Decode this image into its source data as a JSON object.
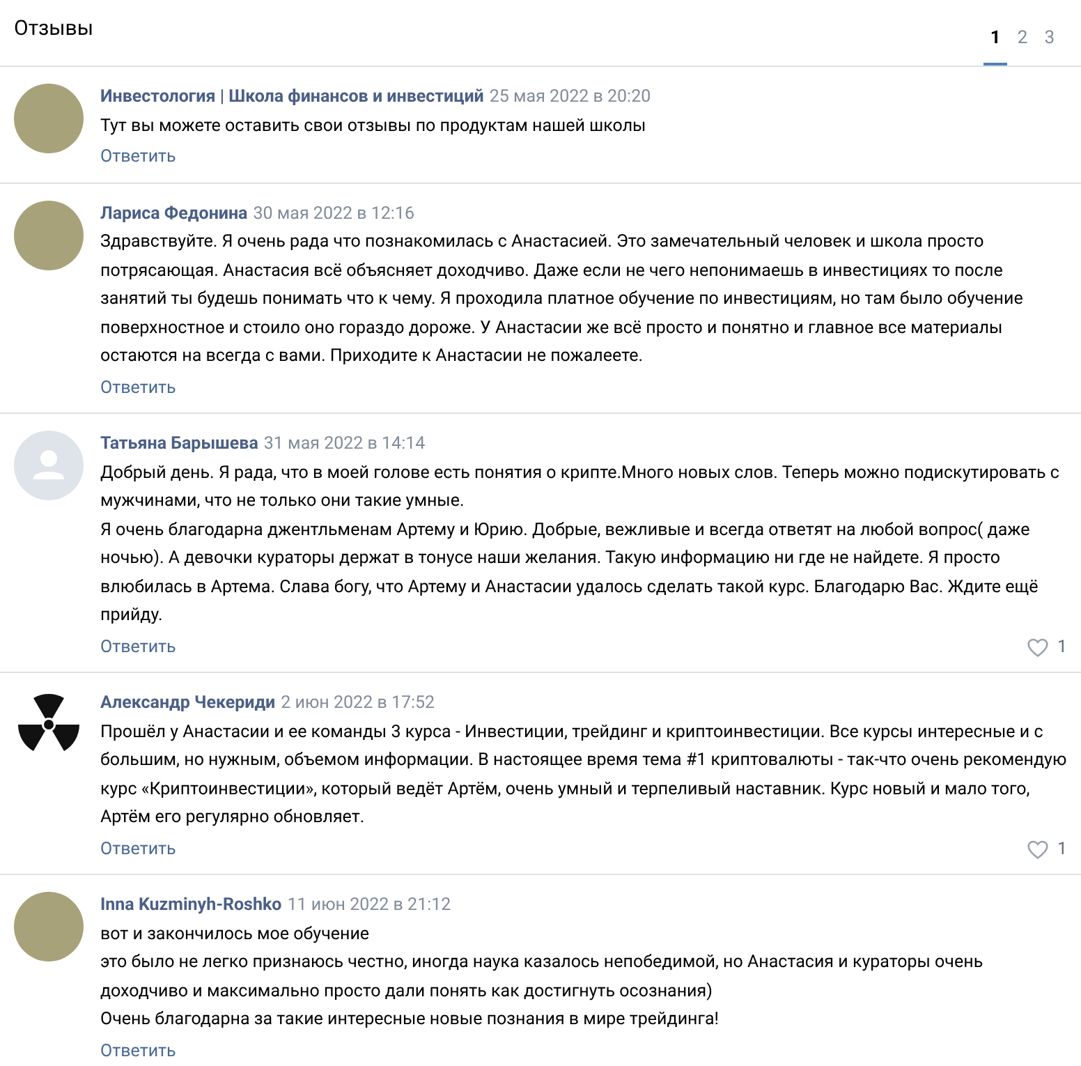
{
  "title": "Отзывы",
  "pages": [
    {
      "label": "1",
      "selected": true
    },
    {
      "label": "2",
      "selected": false
    },
    {
      "label": "3",
      "selected": false
    }
  ],
  "comments": [
    {
      "kind": "photo",
      "author": "Инвестология | Школа финансов и инвестиций",
      "date": "25 мая 2022 в 20:20",
      "paragraphs": [
        "Тут вы можете оставить свои отзывы по продуктам нашей школы"
      ],
      "reply": "Ответить"
    },
    {
      "kind": "photo",
      "author": "Лариса Федонина",
      "date": "30 мая 2022 в 12:16",
      "paragraphs": [
        "Здравствуйте. Я очень рада что познакомилась с Анастасией. Это замечательный человек и школа просто потрясающая. Анастасия всё объясняет доходчиво. Даже если не чего непонимаешь в инвестициях то после занятий ты будешь понимать что к чему. Я проходила платное обучение по инвестициям, но там было обучение поверхностное и стоило оно гораздо дороже. У Анастасии же всё просто и понятно и главное все материалы остаются на всегда с вами. Приходите к Анастасии не пожалеете."
      ],
      "reply": "Ответить"
    },
    {
      "kind": "silhouette",
      "author": "Татьяна Барышева",
      "date": "31 мая 2022 в 14:14",
      "paragraphs": [
        "Добрый день. Я рада, что в моей голове есть понятия о крипте.Много новых слов. Теперь можно подискутировать с мужчинами, что не только они такие умные.",
        "Я очень благодарна джентльменам Артему и Юрию. Добрые, вежливые и всегда ответят на любой вопрос( даже ночью). А девочки кураторы держат в тонусе наши желания. Такую информацию ни где не найдете. Я просто влюбилась в Артема. Слава богу, что Артему и Анастасии удалось сделать такой курс. Благодарю Вас. Ждите ещё прийду."
      ],
      "reply": "Ответить",
      "likes": "1"
    },
    {
      "kind": "radiation",
      "author": "Александр Чекериди",
      "date": "2 июн 2022 в 17:52",
      "paragraphs": [
        "Прошёл у Анастасии и ее команды 3 курса - Инвестиции, трейдинг и криптоинвестиции. Все курсы интересные и с большим, но нужным, объемом информации. В настоящее время тема #1 криптовалюты - так-что очень рекомендую курс «Криптоинвестиции», который ведёт Артём, очень умный и терпеливый наставник. Курс новый и мало того, Артём его регулярно обновляет."
      ],
      "reply": "Ответить",
      "likes": "1"
    },
    {
      "kind": "photo",
      "author": "Inna Kuzminyh-Roshko",
      "date": "11 июн 2022 в 21:12",
      "paragraphs": [
        "вот и закончилось мое обучение",
        "это было не легко признаюсь честно, иногда наука казалось непобедимой, но Анастасия и кураторы очень доходчиво и максимально просто дали понять как достигнуть осознания)",
        "Очень благодарна за такие интересные новые познания в мире трейдинга!"
      ],
      "reply": "Ответить"
    }
  ]
}
